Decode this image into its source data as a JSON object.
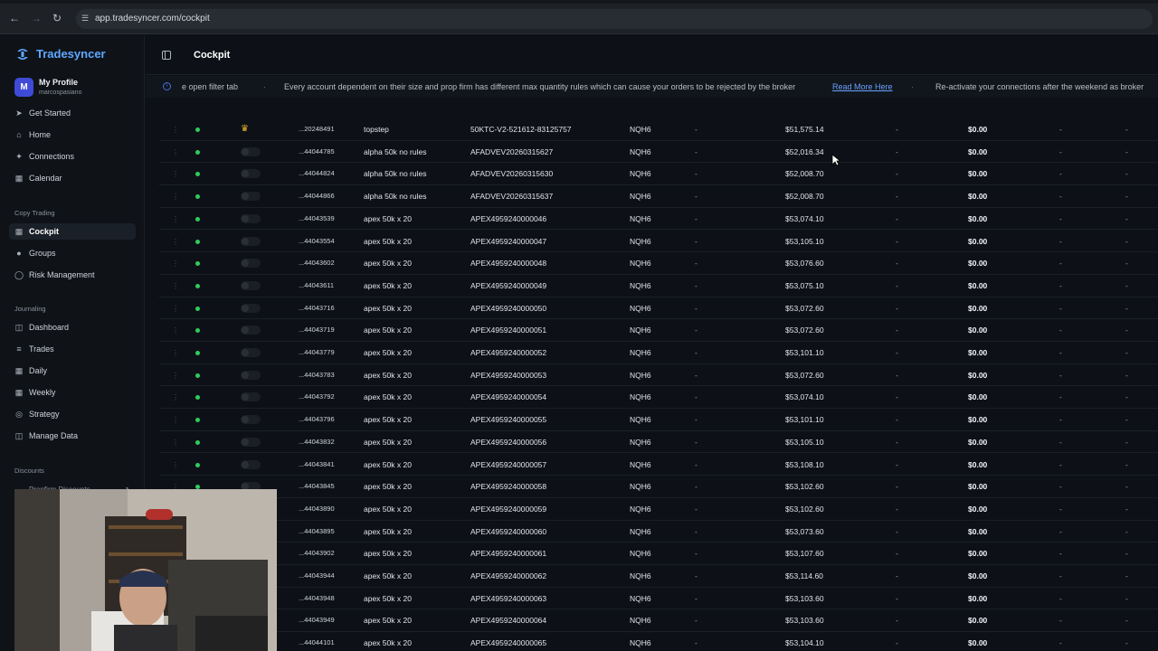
{
  "browser": {
    "url": "app.tradesyncer.com/cockpit"
  },
  "sidebar": {
    "brand": "Tradesyncer",
    "profile": {
      "initial": "M",
      "name": "My Profile",
      "username": "marcospasiano"
    },
    "main_items": [
      {
        "label": "Get Started",
        "icon": "rocket-icon"
      },
      {
        "label": "Home",
        "icon": "home-icon"
      },
      {
        "label": "Connections",
        "icon": "link-icon"
      },
      {
        "label": "Calendar",
        "icon": "calendar-icon"
      }
    ],
    "copy_trading_label": "Copy Trading",
    "copy_items": [
      {
        "label": "Cockpit",
        "icon": "grid-icon",
        "active": true
      },
      {
        "label": "Groups",
        "icon": "users-icon"
      },
      {
        "label": "Risk Management",
        "icon": "shield-icon"
      }
    ],
    "journaling_label": "Journaling",
    "journal_items": [
      {
        "label": "Dashboard",
        "icon": "dashboard-icon"
      },
      {
        "label": "Trades",
        "icon": "list-icon"
      },
      {
        "label": "Daily",
        "icon": "calendar-day-icon"
      },
      {
        "label": "Weekly",
        "icon": "calendar-week-icon"
      },
      {
        "label": "Strategy",
        "icon": "target-icon"
      },
      {
        "label": "Manage Data",
        "icon": "database-icon"
      }
    ],
    "discounts_label": "Discounts",
    "discount_item": "Propfirm Discounts"
  },
  "header": {
    "title": "Cockpit"
  },
  "ticker": {
    "items": [
      "e open filter tab",
      "Every account dependent on their size and prop firm has different max quantity rules which can cause your orders to be rejected by the broker",
      "Re-activate your connections after the weekend as broker"
    ],
    "link": "Read More Here"
  },
  "accounts": [
    {
      "id": "...20248491",
      "name": "topstep",
      "account": "50KTC-V2-521612-83125757",
      "symbol": "NQH6",
      "d1": "-",
      "balance": "$51,575.14",
      "d2": "-",
      "pnl": "$0.00",
      "d3": "-",
      "d4": "-",
      "leader": true
    },
    {
      "id": "...44044785",
      "name": "alpha 50k no rules",
      "account": "AFADVEV20260315627",
      "symbol": "NQH6",
      "d1": "-",
      "balance": "$52,016.34",
      "d2": "-",
      "pnl": "$0.00",
      "d3": "-",
      "d4": "-"
    },
    {
      "id": "...44044824",
      "name": "alpha 50k no rules",
      "account": "AFADVEV20260315630",
      "symbol": "NQH6",
      "d1": "-",
      "balance": "$52,008.70",
      "d2": "-",
      "pnl": "$0.00",
      "d3": "-",
      "d4": "-"
    },
    {
      "id": "...44044866",
      "name": "alpha 50k no rules",
      "account": "AFADVEV20260315637",
      "symbol": "NQH6",
      "d1": "-",
      "balance": "$52,008.70",
      "d2": "-",
      "pnl": "$0.00",
      "d3": "-",
      "d4": "-"
    },
    {
      "id": "...44043539",
      "name": "apex 50k x 20",
      "account": "APEX4959240000046",
      "symbol": "NQH6",
      "d1": "-",
      "balance": "$53,074.10",
      "d2": "-",
      "pnl": "$0.00",
      "d3": "-",
      "d4": "-"
    },
    {
      "id": "...44043554",
      "name": "apex 50k x 20",
      "account": "APEX4959240000047",
      "symbol": "NQH6",
      "d1": "-",
      "balance": "$53,105.10",
      "d2": "-",
      "pnl": "$0.00",
      "d3": "-",
      "d4": "-"
    },
    {
      "id": "...44043602",
      "name": "apex 50k x 20",
      "account": "APEX4959240000048",
      "symbol": "NQH6",
      "d1": "-",
      "balance": "$53,076.60",
      "d2": "-",
      "pnl": "$0.00",
      "d3": "-",
      "d4": "-"
    },
    {
      "id": "...44043611",
      "name": "apex 50k x 20",
      "account": "APEX4959240000049",
      "symbol": "NQH6",
      "d1": "-",
      "balance": "$53,075.10",
      "d2": "-",
      "pnl": "$0.00",
      "d3": "-",
      "d4": "-"
    },
    {
      "id": "...44043716",
      "name": "apex 50k x 20",
      "account": "APEX4959240000050",
      "symbol": "NQH6",
      "d1": "-",
      "balance": "$53,072.60",
      "d2": "-",
      "pnl": "$0.00",
      "d3": "-",
      "d4": "-"
    },
    {
      "id": "...44043719",
      "name": "apex 50k x 20",
      "account": "APEX4959240000051",
      "symbol": "NQH6",
      "d1": "-",
      "balance": "$53,072.60",
      "d2": "-",
      "pnl": "$0.00",
      "d3": "-",
      "d4": "-"
    },
    {
      "id": "...44043779",
      "name": "apex 50k x 20",
      "account": "APEX4959240000052",
      "symbol": "NQH6",
      "d1": "-",
      "balance": "$53,101.10",
      "d2": "-",
      "pnl": "$0.00",
      "d3": "-",
      "d4": "-"
    },
    {
      "id": "...44043783",
      "name": "apex 50k x 20",
      "account": "APEX4959240000053",
      "symbol": "NQH6",
      "d1": "-",
      "balance": "$53,072.60",
      "d2": "-",
      "pnl": "$0.00",
      "d3": "-",
      "d4": "-"
    },
    {
      "id": "...44043792",
      "name": "apex 50k x 20",
      "account": "APEX4959240000054",
      "symbol": "NQH6",
      "d1": "-",
      "balance": "$53,074.10",
      "d2": "-",
      "pnl": "$0.00",
      "d3": "-",
      "d4": "-"
    },
    {
      "id": "...44043796",
      "name": "apex 50k x 20",
      "account": "APEX4959240000055",
      "symbol": "NQH6",
      "d1": "-",
      "balance": "$53,101.10",
      "d2": "-",
      "pnl": "$0.00",
      "d3": "-",
      "d4": "-"
    },
    {
      "id": "...44043832",
      "name": "apex 50k x 20",
      "account": "APEX4959240000056",
      "symbol": "NQH6",
      "d1": "-",
      "balance": "$53,105.10",
      "d2": "-",
      "pnl": "$0.00",
      "d3": "-",
      "d4": "-"
    },
    {
      "id": "...44043841",
      "name": "apex 50k x 20",
      "account": "APEX4959240000057",
      "symbol": "NQH6",
      "d1": "-",
      "balance": "$53,108.10",
      "d2": "-",
      "pnl": "$0.00",
      "d3": "-",
      "d4": "-"
    },
    {
      "id": "...44043845",
      "name": "apex 50k x 20",
      "account": "APEX4959240000058",
      "symbol": "NQH6",
      "d1": "-",
      "balance": "$53,102.60",
      "d2": "-",
      "pnl": "$0.00",
      "d3": "-",
      "d4": "-"
    },
    {
      "id": "...44043890",
      "name": "apex 50k x 20",
      "account": "APEX4959240000059",
      "symbol": "NQH6",
      "d1": "-",
      "balance": "$53,102.60",
      "d2": "-",
      "pnl": "$0.00",
      "d3": "-",
      "d4": "-"
    },
    {
      "id": "...44043895",
      "name": "apex 50k x 20",
      "account": "APEX4959240000060",
      "symbol": "NQH6",
      "d1": "-",
      "balance": "$53,073.60",
      "d2": "-",
      "pnl": "$0.00",
      "d3": "-",
      "d4": "-"
    },
    {
      "id": "...44043902",
      "name": "apex 50k x 20",
      "account": "APEX4959240000061",
      "symbol": "NQH6",
      "d1": "-",
      "balance": "$53,107.60",
      "d2": "-",
      "pnl": "$0.00",
      "d3": "-",
      "d4": "-"
    },
    {
      "id": "...44043944",
      "name": "apex 50k x 20",
      "account": "APEX4959240000062",
      "symbol": "NQH6",
      "d1": "-",
      "balance": "$53,114.60",
      "d2": "-",
      "pnl": "$0.00",
      "d3": "-",
      "d4": "-"
    },
    {
      "id": "...44043948",
      "name": "apex 50k x 20",
      "account": "APEX4959240000063",
      "symbol": "NQH6",
      "d1": "-",
      "balance": "$53,103.60",
      "d2": "-",
      "pnl": "$0.00",
      "d3": "-",
      "d4": "-"
    },
    {
      "id": "...44043949",
      "name": "apex 50k x 20",
      "account": "APEX4959240000064",
      "symbol": "NQH6",
      "d1": "-",
      "balance": "$53,103.60",
      "d2": "-",
      "pnl": "$0.00",
      "d3": "-",
      "d4": "-"
    },
    {
      "id": "...44044101",
      "name": "apex 50k x 20",
      "account": "APEX4959240000065",
      "symbol": "NQH6",
      "d1": "-",
      "balance": "$53,104.10",
      "d2": "-",
      "pnl": "$0.00",
      "d3": "-",
      "d4": "-"
    }
  ],
  "colors": {
    "accent": "#5fa8ff",
    "status_online": "#2ecc5a",
    "leader_crown": "#e8b923",
    "link": "#6aa2ff"
  }
}
